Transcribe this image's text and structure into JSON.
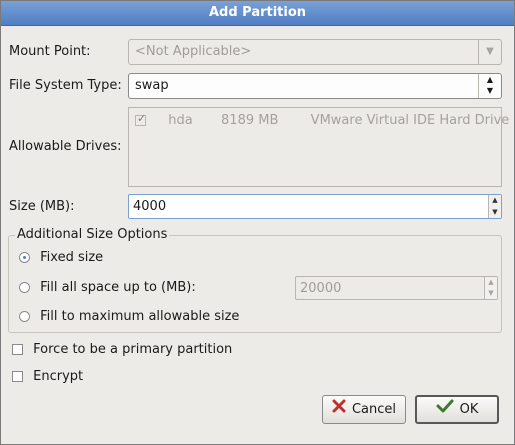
{
  "window": {
    "title": "Add Partition"
  },
  "mount_point": {
    "label": "Mount Point:",
    "value": "<Not Applicable>"
  },
  "fs_type": {
    "label": "File System Type:",
    "value": "swap"
  },
  "drives": {
    "label": "Allowable Drives:",
    "items": [
      {
        "name": "hda",
        "size": "8189 MB",
        "model": "VMware Virtual IDE Hard Drive",
        "checked": true
      }
    ]
  },
  "size": {
    "label": "Size (MB):",
    "value": "4000"
  },
  "size_options": {
    "legend": "Additional Size Options",
    "fixed": "Fixed size",
    "fill_up_to": "Fill all space up to (MB):",
    "fill_up_to_value": "20000",
    "fill_max": "Fill to maximum allowable size",
    "selected": "fixed"
  },
  "primary": {
    "label": "Force to be a primary partition",
    "checked": false
  },
  "encrypt": {
    "label": "Encrypt",
    "checked": false
  },
  "buttons": {
    "cancel": "Cancel",
    "ok": "OK"
  },
  "icons": {
    "cancel": "cancel-x-icon",
    "ok": "ok-checkmark-icon",
    "combo": "chevron-down-icon"
  },
  "colors": {
    "titlebar": "#4f7fc4",
    "dialog_bg": "#edebe7"
  }
}
